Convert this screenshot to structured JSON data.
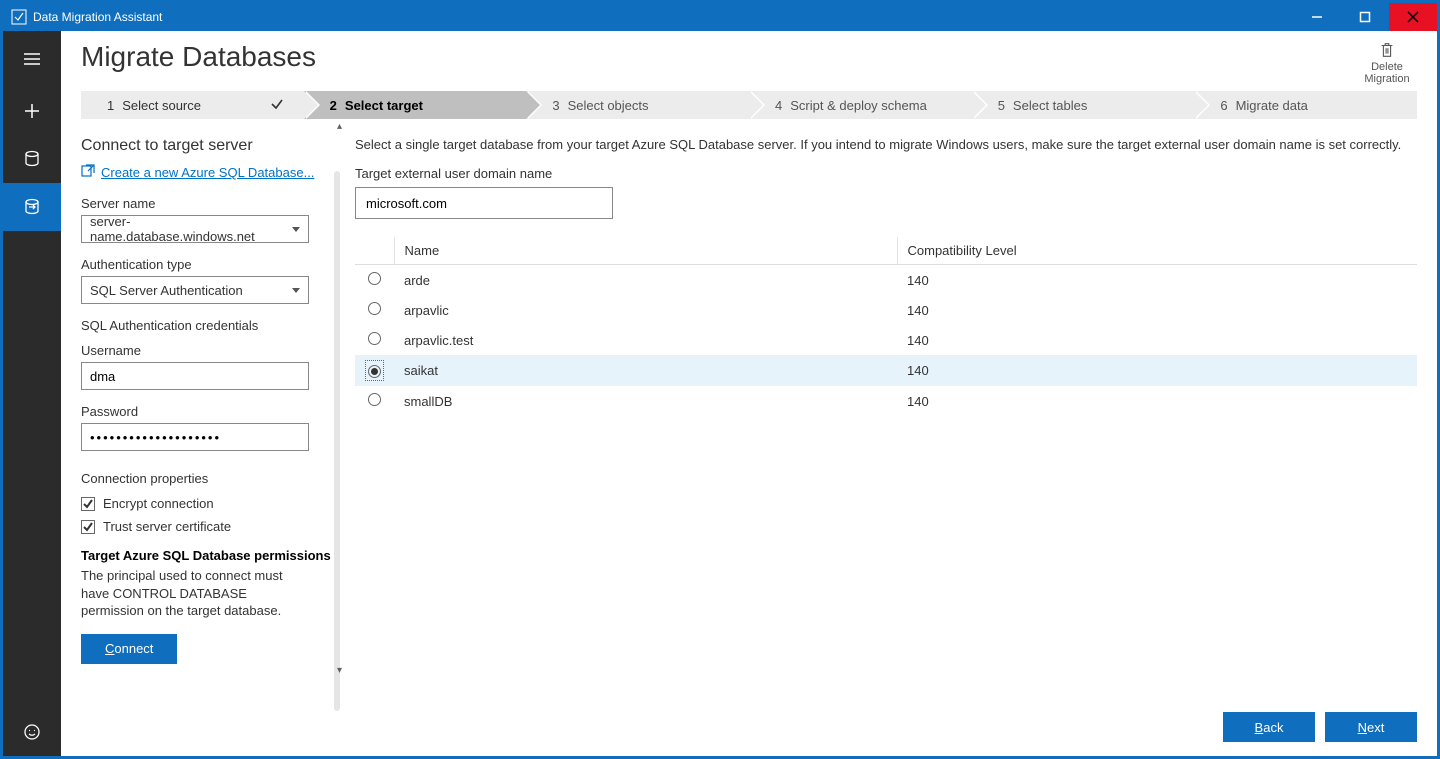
{
  "titlebar": {
    "title": "Data Migration Assistant"
  },
  "header": {
    "page_title": "Migrate Databases",
    "delete_label": "Delete Migration"
  },
  "steps": [
    {
      "num": "1",
      "label": "Select source",
      "state": "done"
    },
    {
      "num": "2",
      "label": "Select target",
      "state": "current"
    },
    {
      "num": "3",
      "label": "Select objects",
      "state": ""
    },
    {
      "num": "4",
      "label": "Script & deploy schema",
      "state": ""
    },
    {
      "num": "5",
      "label": "Select tables",
      "state": ""
    },
    {
      "num": "6",
      "label": "Migrate data",
      "state": ""
    }
  ],
  "side": {
    "heading": "Connect to target server",
    "create_link": "Create a new Azure SQL Database...",
    "server_name_label": "Server name",
    "server_name_value": "server-name.database.windows.net",
    "auth_type_label": "Authentication type",
    "auth_type_value": "SQL Server Authentication",
    "creds_label": "SQL Authentication credentials",
    "username_label": "Username",
    "username_value": "dma",
    "password_label": "Password",
    "password_value": "••••••••••••••••••••",
    "conn_props_label": "Connection properties",
    "encrypt_label": "Encrypt connection",
    "trust_label": "Trust server certificate",
    "perm_title": "Target Azure SQL Database permissions",
    "perm_text": "The principal used to connect must have CONTROL DATABASE permission on the target database.",
    "connect_prefix": "C",
    "connect_rest": "onnect"
  },
  "main": {
    "instruction": "Select a single target database from your target Azure SQL Database server. If you intend to migrate Windows users, make sure the target external user domain name is set correctly.",
    "domain_label": "Target external user domain name",
    "domain_value": "microsoft.com",
    "col_name": "Name",
    "col_compat": "Compatibility Level",
    "rows": [
      {
        "name": "arde",
        "compat": "140",
        "selected": false
      },
      {
        "name": "arpavlic",
        "compat": "140",
        "selected": false
      },
      {
        "name": "arpavlic.test",
        "compat": "140",
        "selected": false
      },
      {
        "name": "saikat",
        "compat": "140",
        "selected": true
      },
      {
        "name": "smallDB",
        "compat": "140",
        "selected": false
      }
    ]
  },
  "footer": {
    "back_prefix": "B",
    "back_rest": "ack",
    "next_prefix": "N",
    "next_rest": "ext"
  }
}
